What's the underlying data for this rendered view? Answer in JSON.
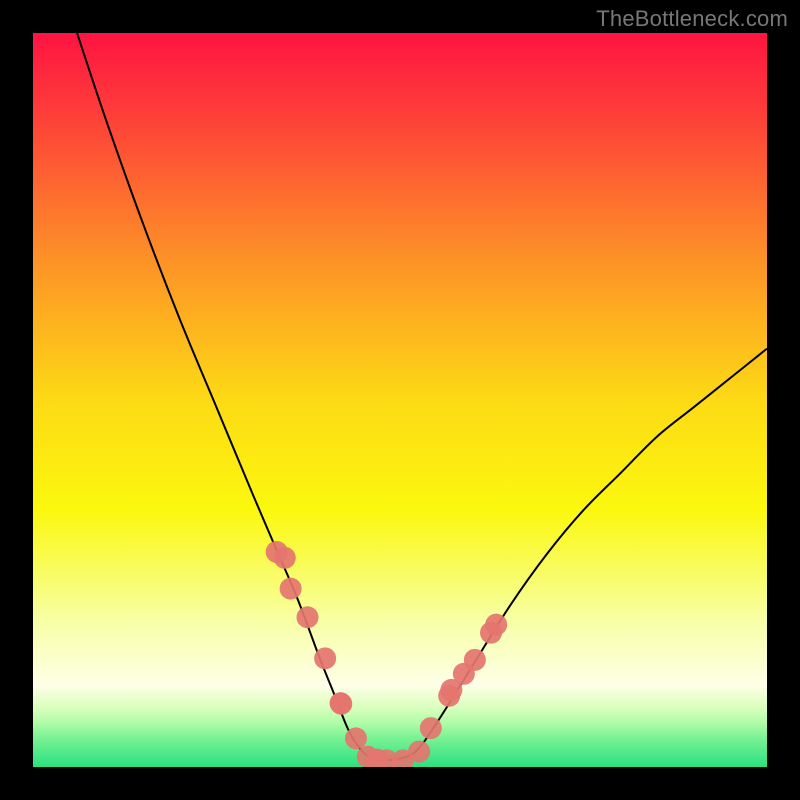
{
  "watermark": "TheBottleneck.com",
  "chart_data": {
    "type": "line",
    "title": "",
    "xlabel": "",
    "ylabel": "",
    "xlim": [
      0,
      100
    ],
    "ylim": [
      0,
      100
    ],
    "legend": false,
    "grid": false,
    "annotations": [],
    "background_gradient": {
      "stops": [
        {
          "y_percent": 0,
          "color": "#fe1441"
        },
        {
          "y_percent": 10,
          "color": "#fe3a3a"
        },
        {
          "y_percent": 30,
          "color": "#fd8e28"
        },
        {
          "y_percent": 50,
          "color": "#fdda15"
        },
        {
          "y_percent": 65,
          "color": "#fbf80e"
        },
        {
          "y_percent": 80,
          "color": "#f7ffa5"
        },
        {
          "y_percent": 89,
          "color": "#feffe8"
        },
        {
          "y_percent": 90,
          "color": "#f1ffd6"
        },
        {
          "y_percent": 92,
          "color": "#d7ffbd"
        },
        {
          "y_percent": 94,
          "color": "#b0fca7"
        },
        {
          "y_percent": 96,
          "color": "#7af295"
        },
        {
          "y_percent": 100,
          "color": "#2ae180"
        }
      ]
    },
    "series": [
      {
        "name": "bottleneck-curve",
        "type": "line",
        "color": "#000000",
        "stroke_width": 2,
        "x": [
          6,
          10,
          15,
          20,
          25,
          30,
          33,
          36,
          39,
          41,
          43,
          45,
          47,
          49,
          52,
          55,
          60,
          65,
          70,
          75,
          80,
          85,
          90,
          95,
          100
        ],
        "y": [
          100,
          88,
          74,
          61,
          49,
          37,
          30,
          23,
          15,
          10,
          5,
          2,
          1,
          1,
          2,
          6,
          14,
          22,
          29,
          35,
          40,
          45,
          49,
          53,
          57
        ]
      },
      {
        "name": "markers-left",
        "type": "scatter",
        "color": "#e4756f",
        "marker_radius": 11,
        "x": [
          33.2,
          34.3,
          35.1,
          37.4,
          39.8,
          41.9,
          42.0,
          44.0,
          45.6,
          46.9,
          48.2
        ],
        "y": [
          29.3,
          28.5,
          24.3,
          20.4,
          14.8,
          8.7,
          8.6,
          3.9,
          1.4,
          1.0,
          0.9
        ]
      },
      {
        "name": "markers-right",
        "type": "scatter",
        "color": "#e4756f",
        "marker_radius": 11,
        "x": [
          50.4,
          52.6,
          54.2,
          56.7,
          57.0,
          58.7,
          60.2,
          62.4,
          63.1
        ],
        "y": [
          0.9,
          2.1,
          5.3,
          9.7,
          10.5,
          12.7,
          14.6,
          18.3,
          19.4
        ]
      }
    ]
  }
}
